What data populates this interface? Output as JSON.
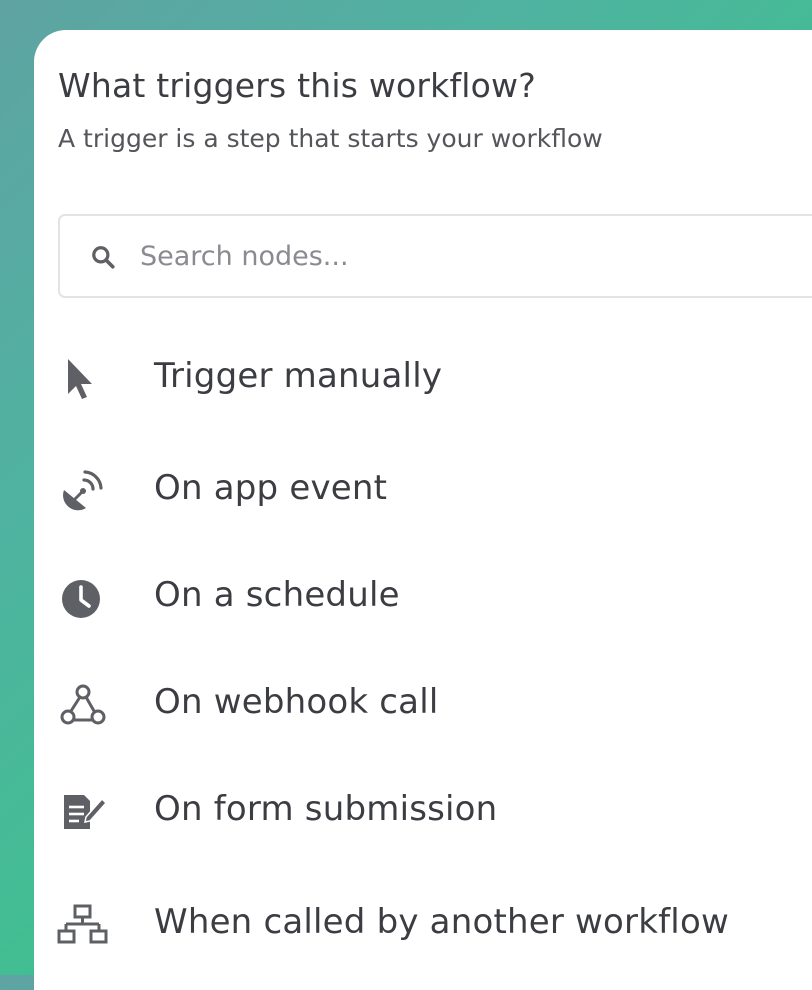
{
  "panel": {
    "title": "What triggers this workflow?",
    "subtitle": "A trigger is a step that starts your workflow"
  },
  "search": {
    "placeholder": "Search nodes...",
    "value": ""
  },
  "triggers": [
    {
      "label": "Trigger manually",
      "icon": "cursor-icon"
    },
    {
      "label": "On app event",
      "icon": "satellite-dish-icon"
    },
    {
      "label": "On a schedule",
      "icon": "clock-icon"
    },
    {
      "label": "On webhook call",
      "icon": "webhook-icon"
    },
    {
      "label": "On form submission",
      "icon": "form-edit-icon"
    },
    {
      "label": "When called by another workflow",
      "icon": "sitemap-icon"
    }
  ],
  "colors": {
    "icon": "#5f6066",
    "text": "#3c3d42",
    "background_gradient_start": "#5fa3a3",
    "background_gradient_end": "#36c685"
  }
}
